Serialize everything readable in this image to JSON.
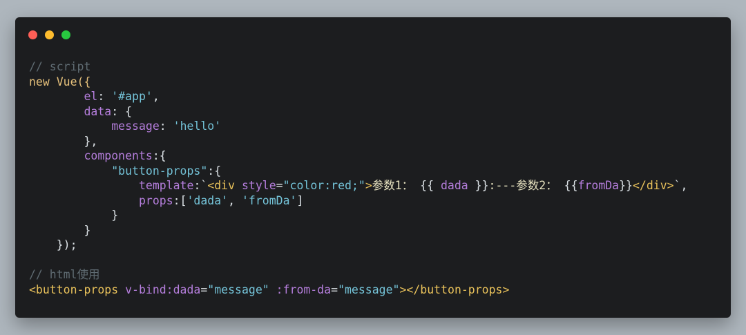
{
  "window": {
    "controls": {
      "close_color": "#fe5f57",
      "minimize_color": "#febc2e",
      "maximize_color": "#28c840"
    }
  },
  "code": {
    "lines": [
      [
        {
          "text": "// script",
          "type": "comment"
        }
      ],
      [
        {
          "text": "new Vue({",
          "type": "kw"
        }
      ],
      [
        {
          "text": "        ",
          "type": "punc"
        },
        {
          "text": "el",
          "type": "prop"
        },
        {
          "text": ": ",
          "type": "punc"
        },
        {
          "text": "'#app'",
          "type": "str"
        },
        {
          "text": ",",
          "type": "punc"
        }
      ],
      [
        {
          "text": "        ",
          "type": "punc"
        },
        {
          "text": "data",
          "type": "prop"
        },
        {
          "text": ": {",
          "type": "punc"
        }
      ],
      [
        {
          "text": "            ",
          "type": "punc"
        },
        {
          "text": "message",
          "type": "prop"
        },
        {
          "text": ": ",
          "type": "punc"
        },
        {
          "text": "'hello'",
          "type": "str"
        }
      ],
      [
        {
          "text": "        },",
          "type": "punc"
        }
      ],
      [
        {
          "text": "        ",
          "type": "punc"
        },
        {
          "text": "components",
          "type": "prop"
        },
        {
          "text": ":{",
          "type": "punc"
        }
      ],
      [
        {
          "text": "            ",
          "type": "punc"
        },
        {
          "text": "\"button-props\"",
          "type": "str"
        },
        {
          "text": ":{",
          "type": "punc"
        }
      ],
      [
        {
          "text": "                ",
          "type": "punc"
        },
        {
          "text": "template",
          "type": "prop"
        },
        {
          "text": ":`",
          "type": "punc"
        },
        {
          "text": "<div",
          "type": "tag"
        },
        {
          "text": " ",
          "type": "punc"
        },
        {
          "text": "style",
          "type": "attr"
        },
        {
          "text": "=",
          "type": "punc"
        },
        {
          "text": "\"color:red;\"",
          "type": "str"
        },
        {
          "text": ">",
          "type": "tag"
        },
        {
          "text": "参数1： ",
          "type": "text"
        },
        {
          "text": "{{ ",
          "type": "punc"
        },
        {
          "text": "dada",
          "type": "prop"
        },
        {
          "text": " }}",
          "type": "punc"
        },
        {
          "text": ":---",
          "type": "text"
        },
        {
          "text": "参数2： ",
          "type": "text"
        },
        {
          "text": "{{",
          "type": "punc"
        },
        {
          "text": "fromDa",
          "type": "prop"
        },
        {
          "text": "}}",
          "type": "punc"
        },
        {
          "text": "</div>",
          "type": "tag"
        },
        {
          "text": "`,",
          "type": "punc"
        }
      ],
      [
        {
          "text": "                ",
          "type": "punc"
        },
        {
          "text": "props",
          "type": "prop"
        },
        {
          "text": ":[",
          "type": "punc"
        },
        {
          "text": "'dada'",
          "type": "str"
        },
        {
          "text": ", ",
          "type": "punc"
        },
        {
          "text": "'fromDa'",
          "type": "str"
        },
        {
          "text": "]",
          "type": "punc"
        }
      ],
      [
        {
          "text": "            }",
          "type": "punc"
        }
      ],
      [
        {
          "text": "        }",
          "type": "punc"
        }
      ],
      [
        {
          "text": "    });",
          "type": "punc"
        }
      ],
      [
        {
          "text": "",
          "type": "punc"
        }
      ],
      [
        {
          "text": "// html使用",
          "type": "comment"
        }
      ],
      [
        {
          "text": "<button-props",
          "type": "tag"
        },
        {
          "text": " ",
          "type": "punc"
        },
        {
          "text": "v-bind:dada",
          "type": "attr"
        },
        {
          "text": "=",
          "type": "punc"
        },
        {
          "text": "\"message\"",
          "type": "str"
        },
        {
          "text": " ",
          "type": "punc"
        },
        {
          "text": ":from-da",
          "type": "attr"
        },
        {
          "text": "=",
          "type": "punc"
        },
        {
          "text": "\"message\"",
          "type": "str"
        },
        {
          "text": "></button-props>",
          "type": "tag"
        }
      ]
    ]
  }
}
